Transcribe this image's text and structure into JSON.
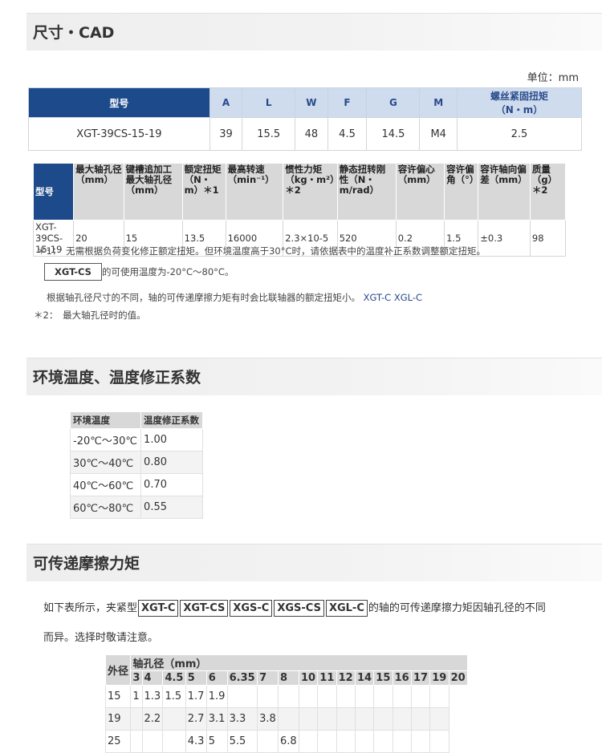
{
  "sections": {
    "s1": "尺寸・CAD",
    "s2": "环境温度、温度修正系数",
    "s3": "可传递摩擦力矩"
  },
  "unit_label": "单位：mm",
  "t1": {
    "headers": [
      "型号",
      "A",
      "L",
      "W",
      "F",
      "G",
      "M",
      "螺丝紧固扭矩\n（N・m）"
    ],
    "row": [
      "XGT-39CS-15-19",
      "39",
      "15.5",
      "48",
      "4.5",
      "14.5",
      "M4",
      "2.5"
    ]
  },
  "t2": {
    "headers": [
      "型号",
      "最大轴孔径（mm）",
      "键槽追加工最大轴孔径（mm）",
      "额定扭矩（N・m）＊1",
      "最高转速（min⁻¹）",
      "惯性力矩（kg・m²）＊2",
      "静态扭转刚性（N・m/rad）",
      "容许偏心（mm）",
      "容许偏角（°）",
      "容许轴向偏差（mm）",
      "质量（g）＊2"
    ],
    "row": [
      "XGT-39CS-15-19",
      "20",
      "15",
      "13.5",
      "16000",
      "2.3×10-5",
      "520",
      "0.2",
      "1.5",
      "±0.3",
      "98"
    ]
  },
  "notes": {
    "n1": "＊1：　无需根据负荷变化修正额定扭矩。但环境温度高于30°C时，请依据表中的温度补正系数调整额定扭矩。",
    "box": "XGT-CS",
    "n2": "的可使用温度为-20°C～80°C。",
    "n3": "根据轴孔径尺寸的不同，轴的可传递摩擦力矩有时会比联轴器的额定扭矩小。",
    "link1": "XGT-C",
    "link2": "XGL-C",
    "n4": "＊2：　最大轴孔径时的值。"
  },
  "t3": {
    "headers": [
      "环境温度",
      "温度修正系数"
    ],
    "rows": [
      [
        "-20℃～30℃",
        "1.00"
      ],
      [
        "30℃～40℃",
        "0.80"
      ],
      [
        "40℃～60℃",
        "0.70"
      ],
      [
        "60℃～80℃",
        "0.55"
      ]
    ]
  },
  "para": {
    "pre": "如下表所示，夹紧型",
    "types": [
      "XGT-C",
      "XGT-CS",
      "XGS-C",
      "XGS-CS",
      "XGL-C"
    ],
    "post": "的轴的可传递摩擦力矩因轴孔径的不同",
    "line2": "而异。选择时敬请注意。"
  },
  "t4": {
    "corner": "外径",
    "group": "轴孔径（mm）",
    "cols": [
      "3",
      "4",
      "4.5",
      "5",
      "6",
      "6.35",
      "7",
      "8",
      "10",
      "11",
      "12",
      "14",
      "15",
      "16",
      "17",
      "19",
      "20"
    ],
    "rows": [
      [
        "15",
        "1",
        "1.3",
        "1.5",
        "1.7",
        "1.9",
        "",
        "",
        "",
        "",
        "",
        "",
        "",
        "",
        "",
        "",
        ""
      ],
      [
        "19",
        "",
        "2.2",
        "",
        "2.7",
        "3.1",
        "3.3",
        "3.8",
        "",
        "",
        "",
        "",
        "",
        "",
        "",
        "",
        ""
      ],
      [
        "25",
        "",
        "",
        "",
        "4.3",
        "5",
        "5.5",
        "",
        "6.8",
        "",
        "",
        "",
        "",
        "",
        "",
        "",
        ""
      ]
    ]
  }
}
